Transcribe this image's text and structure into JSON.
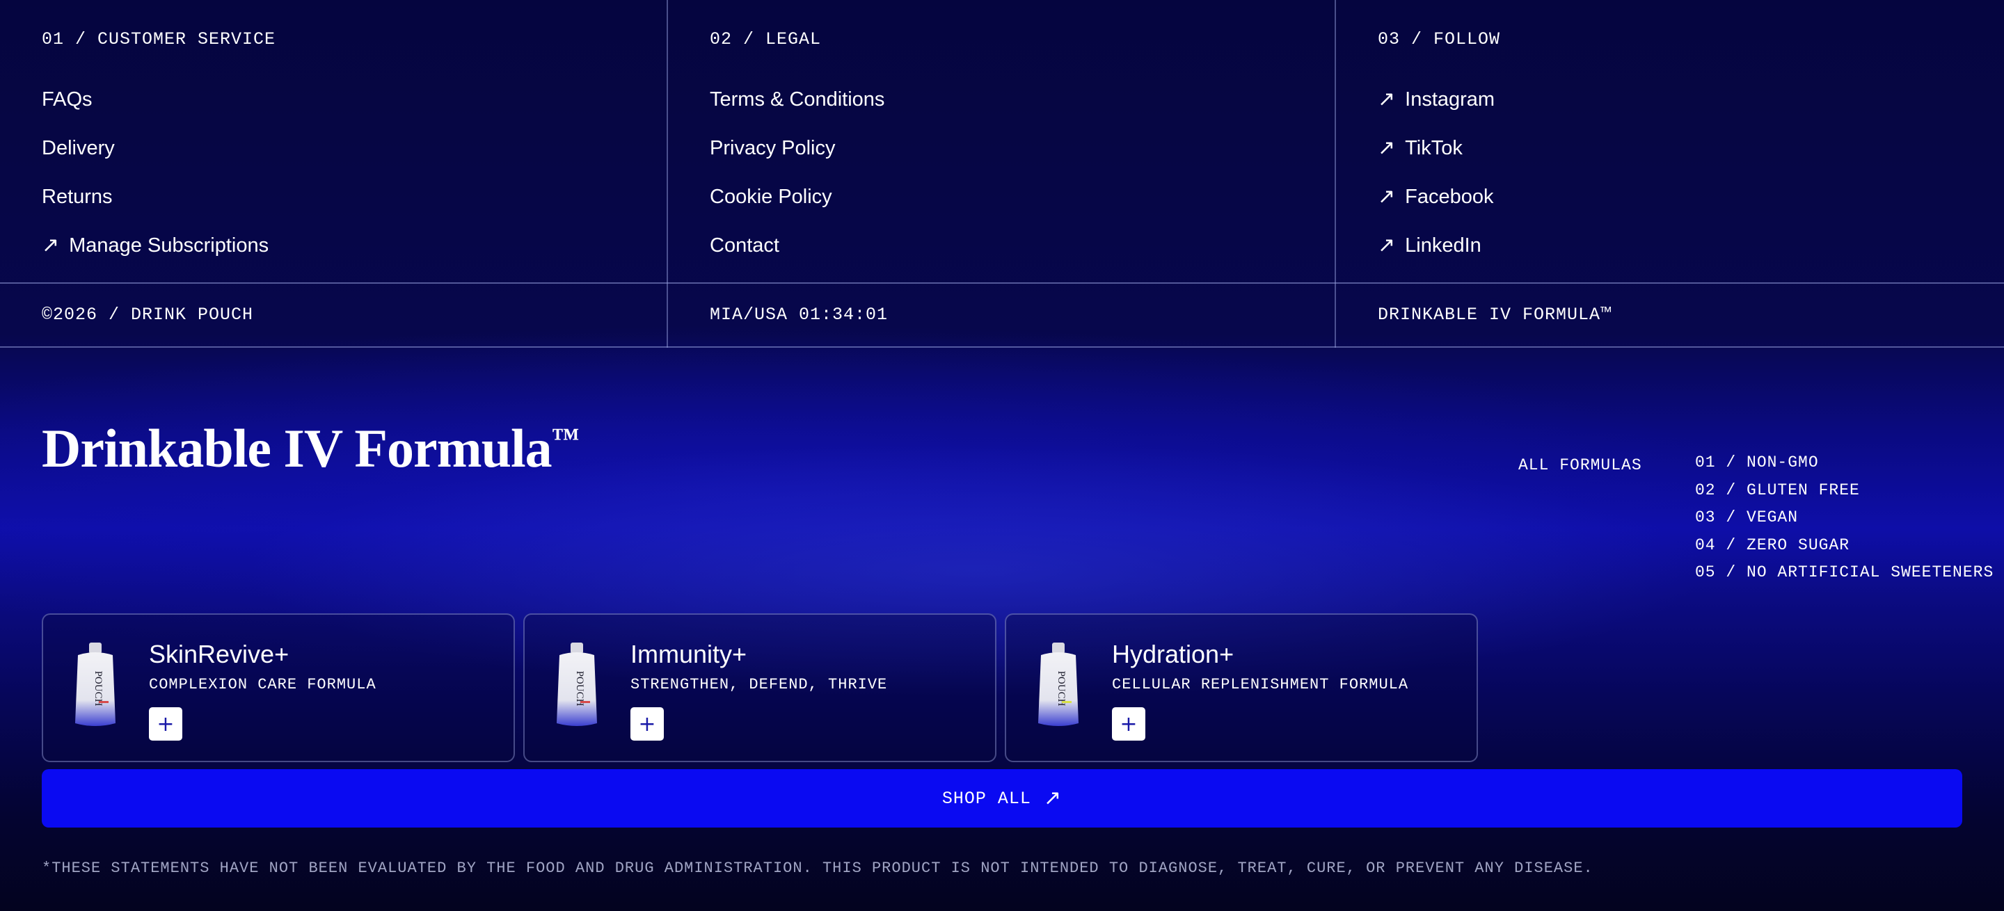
{
  "footer": {
    "columns": [
      {
        "heading": "01 / CUSTOMER SERVICE",
        "links": [
          {
            "label": "FAQs",
            "external": false
          },
          {
            "label": "Delivery",
            "external": false
          },
          {
            "label": "Returns",
            "external": false
          },
          {
            "label": "Manage Subscriptions",
            "external": true
          }
        ]
      },
      {
        "heading": "02 / LEGAL",
        "links": [
          {
            "label": "Terms & Conditions",
            "external": false
          },
          {
            "label": "Privacy Policy",
            "external": false
          },
          {
            "label": "Cookie Policy",
            "external": false
          },
          {
            "label": "Contact",
            "external": false
          }
        ]
      },
      {
        "heading": "03 / FOLLOW",
        "links": [
          {
            "label": "Instagram",
            "external": true
          },
          {
            "label": "TikTok",
            "external": true
          },
          {
            "label": "Facebook",
            "external": true
          },
          {
            "label": "LinkedIn",
            "external": true
          }
        ]
      }
    ],
    "bottom": {
      "copyright": "©2026 / DRINK POUCH",
      "location_time": "MIA/USA 01:34:01",
      "tagline": "DRINKABLE IV FORMULA™"
    },
    "arrow_icon": "↗"
  },
  "hero": {
    "title": "Drinkable IV Formula",
    "trademark": "™",
    "all_formulas_label": "ALL FORMULAS",
    "features": [
      "01 / NON-GMO",
      "02 / GLUTEN FREE",
      "03 / VEGAN",
      "04 / ZERO SUGAR",
      "05 / NO ARTIFICIAL SWEETENERS"
    ]
  },
  "products": [
    {
      "name": "SkinRevive+",
      "subtitle": "COMPLEXION CARE FORMULA",
      "add_label": "+",
      "pouch_label": "POUCH",
      "accent": "#d64b4b"
    },
    {
      "name": "Immunity+",
      "subtitle": "STRENGTHEN, DEFEND, THRIVE",
      "add_label": "+",
      "pouch_label": "POUCH",
      "accent": "#d64b4b"
    },
    {
      "name": "Hydration+",
      "subtitle": "CELLULAR REPLENISHMENT FORMULA",
      "add_label": "+",
      "pouch_label": "POUCH",
      "accent": "#d8e04a"
    }
  ],
  "shop_all": {
    "label": "SHOP ALL",
    "icon": "↗"
  },
  "disclaimer": "*THESE STATEMENTS HAVE NOT BEEN EVALUATED BY THE FOOD AND DRUG ADMINISTRATION. THIS PRODUCT IS NOT INTENDED TO DIAGNOSE, TREAT, CURE, OR PREVENT ANY DISEASE.",
  "colors": {
    "background": "#06064a",
    "button_blue": "#0a0af2",
    "text": "#ffffff"
  }
}
